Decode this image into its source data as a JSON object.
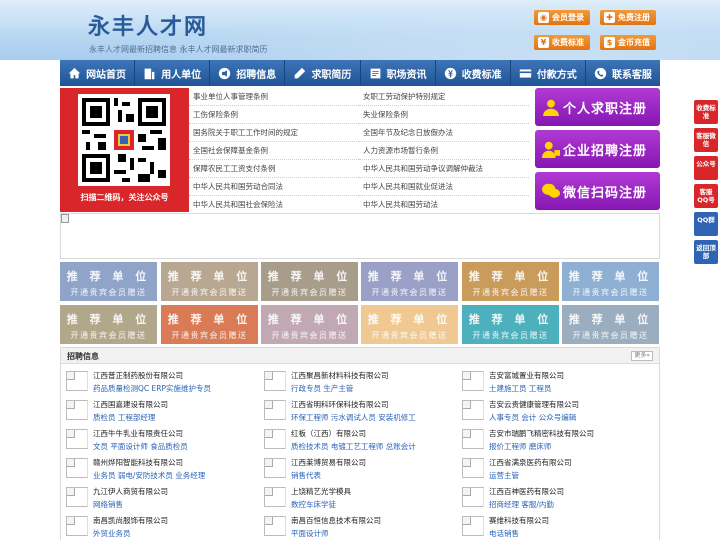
{
  "header": {
    "title": "永丰人才网",
    "subtitle": "永丰人才网最新招聘信息   永丰人才网最新求职简历",
    "buttons": [
      {
        "label": "会员登录",
        "icon": "user-icon"
      },
      {
        "label": "免费注册",
        "icon": "register-icon"
      },
      {
        "label": "收费标准",
        "icon": "yen-icon"
      },
      {
        "label": "金币充值",
        "icon": "coin-icon"
      }
    ]
  },
  "nav": [
    {
      "label": "网站首页",
      "icon": "home-icon"
    },
    {
      "label": "用人单位",
      "icon": "building-icon"
    },
    {
      "label": "招聘信息",
      "icon": "megaphone-icon"
    },
    {
      "label": "求职简历",
      "icon": "pen-icon"
    },
    {
      "label": "职场资讯",
      "icon": "news-icon"
    },
    {
      "label": "收费标准",
      "icon": "yen-icon"
    },
    {
      "label": "付款方式",
      "icon": "card-icon"
    },
    {
      "label": "联系客服",
      "icon": "phone-icon"
    }
  ],
  "qr": {
    "caption": "扫描二维码，关注公众号"
  },
  "regulations": [
    "事业单位人事管理条例",
    "女职工劳动保护特别规定",
    "工伤保险条例",
    "失业保险条例",
    "国务院关于职工工作时间的规定",
    "全国年节及纪念日放假办法",
    "全国社会保障基金条例",
    "人力资源市场暂行条例",
    "保障农民工工资支付条例",
    "中华人民共和国劳动争议调解仲裁法",
    "中华人民共和国劳动合同法",
    "中华人民共和国就业促进法",
    "中华人民共和国社会保险法",
    "中华人民共和国劳动法"
  ],
  "register": [
    {
      "label": "个人求职注册",
      "icon": "person-icon"
    },
    {
      "label": "企业招聘注册",
      "icon": "company-icon"
    },
    {
      "label": "微信扫码注册",
      "icon": "wechat-icon"
    }
  ],
  "recommend": {
    "line1": "推 荐 单 位",
    "line2": "开通贵宾会员赠送",
    "colors": [
      "#8fa4c8",
      "#b8a892",
      "#a89c8a",
      "#9aa0c6",
      "#c99c5c",
      "#8fb0d2",
      "#b1a78a",
      "#d97b55",
      "#c1a9b4",
      "#f0c992",
      "#4db1bd",
      "#9aaec0"
    ]
  },
  "jobs": {
    "title": "招聘信息",
    "more": "更多»",
    "items": [
      {
        "company": "江西普正制药股份有限公司",
        "positions": "药品质量检测QC  ERP实施维护专员"
      },
      {
        "company": "江西聚昌新材料科技有限公司",
        "positions": "行政专员  生产主管"
      },
      {
        "company": "吉安富城置业有限公司",
        "positions": "土建施工员  工程员"
      },
      {
        "company": "江西国嘉建设有限公司",
        "positions": "质检员  工程部经理"
      },
      {
        "company": "江西省明科环保科技有限公司",
        "positions": "环保工程师  污水调试人员  安装机修工"
      },
      {
        "company": "吉安云贵健康管理有限公司",
        "positions": "人事专员  会计  公众号编辑"
      },
      {
        "company": "江西牛牛乳业有限责任公司",
        "positions": "文员  平面设计师  食品质检员"
      },
      {
        "company": "红板（江西）有限公司",
        "positions": "质检技术员  电镀工艺工程师  总账会计"
      },
      {
        "company": "吉安市瑞鹏飞精密科技有限公司",
        "positions": "报价工程师  磨床师"
      },
      {
        "company": "赣州烨阳智能科技有限公司",
        "positions": "业务员  弱电/安防技术员  业务经理"
      },
      {
        "company": "江西莱博贸易有限公司",
        "positions": "销售代表"
      },
      {
        "company": "江西省满泉医药有限公司",
        "positions": "运营主管"
      },
      {
        "company": "九江伊人商贸有限公司",
        "positions": "网络销售"
      },
      {
        "company": "上饶精艺光学模具",
        "positions": "数控车床学徒"
      },
      {
        "company": "江西百神医药有限公司",
        "positions": "招商经理  客服/内勤"
      },
      {
        "company": "南昌凯尚服饰有限公司",
        "positions": "外贸业务员"
      },
      {
        "company": "南昌百恒信息技术有限公司",
        "positions": "平面设计师"
      },
      {
        "company": "赛维科技有限公司",
        "positions": "电话销售"
      }
    ]
  },
  "side": [
    {
      "label": "收费标准"
    },
    {
      "label": "客服微信"
    },
    {
      "label": "公众号"
    },
    {
      "label": "客服QQ号"
    },
    {
      "label": "QQ群"
    },
    {
      "label": "返回顶部"
    }
  ]
}
